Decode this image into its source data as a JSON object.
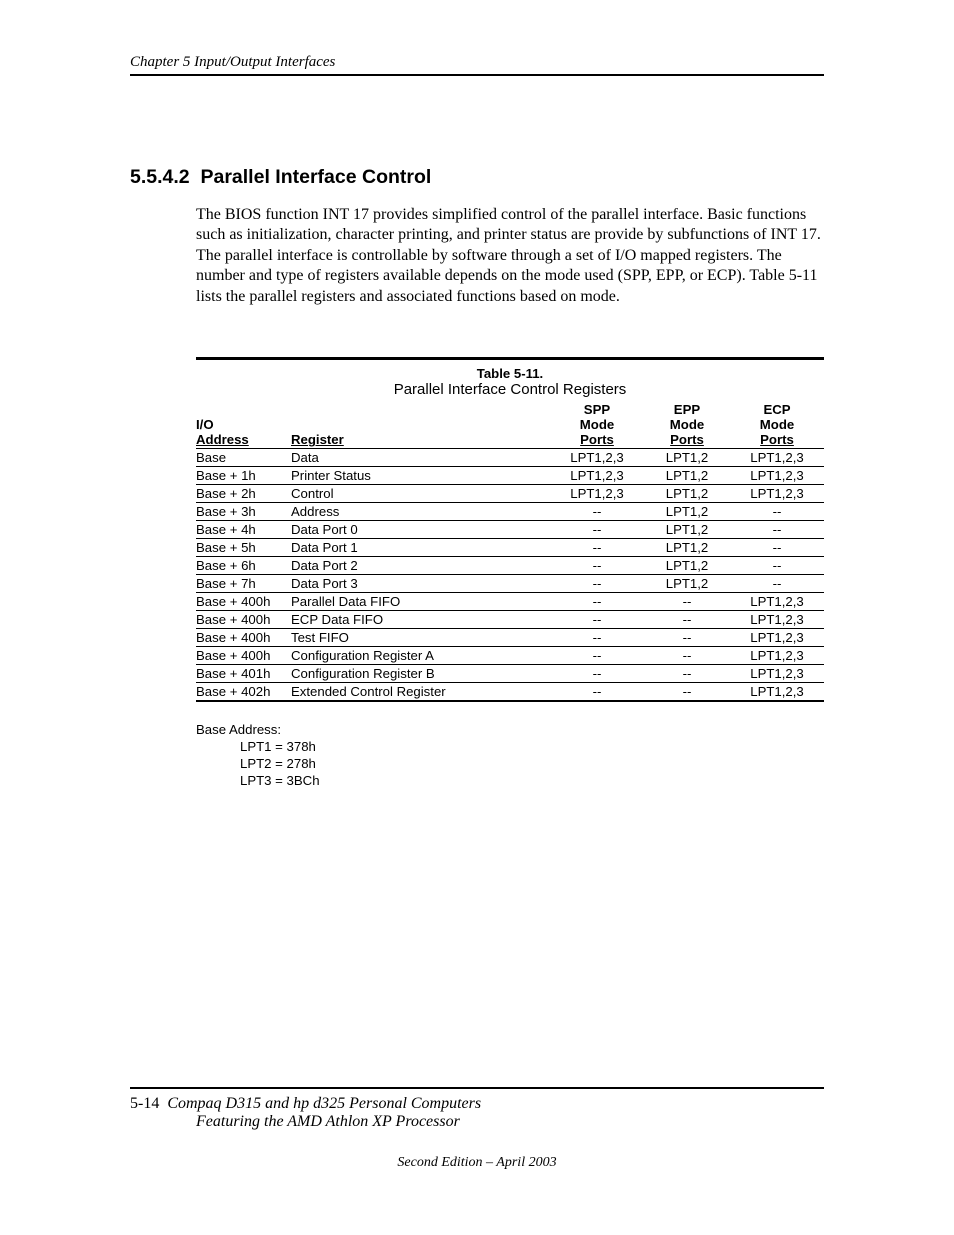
{
  "header": {
    "running": "Chapter 5  Input/Output Interfaces"
  },
  "section": {
    "number": "5.5.4.2",
    "title": "Parallel Interface Control"
  },
  "paragraph": "The BIOS function INT 17 provides simplified control of the parallel interface. Basic functions such as initialization, character printing, and printer status are provide by subfunctions of INT 17. The parallel interface is controllable by software through a set of I/O mapped registers. The number and type of registers available depends on the mode used (SPP, EPP, or ECP). Table 5-11 lists the parallel registers and associated functions based on mode.",
  "table": {
    "number": "Table 5-11.",
    "caption": "Parallel Interface Control Registers",
    "headers": {
      "addr": "I/O Address",
      "reg": "Register",
      "spp": "SPP Mode Ports",
      "epp": "EPP Mode Ports",
      "ecp": "ECP Mode Ports"
    },
    "rows": [
      {
        "addr": "Base",
        "reg": "Data",
        "spp": "LPT1,2,3",
        "epp": "LPT1,2",
        "ecp": "LPT1,2,3"
      },
      {
        "addr": "Base + 1h",
        "reg": "Printer Status",
        "spp": "LPT1,2,3",
        "epp": "LPT1,2",
        "ecp": "LPT1,2,3"
      },
      {
        "addr": "Base + 2h",
        "reg": "Control",
        "spp": "LPT1,2,3",
        "epp": "LPT1,2",
        "ecp": "LPT1,2,3"
      },
      {
        "addr": "Base + 3h",
        "reg": "Address",
        "spp": "--",
        "epp": "LPT1,2",
        "ecp": "--"
      },
      {
        "addr": "Base + 4h",
        "reg": "Data Port 0",
        "spp": "--",
        "epp": "LPT1,2",
        "ecp": "--"
      },
      {
        "addr": "Base + 5h",
        "reg": "Data Port 1",
        "spp": "--",
        "epp": "LPT1,2",
        "ecp": "--"
      },
      {
        "addr": "Base + 6h",
        "reg": "Data Port 2",
        "spp": "--",
        "epp": "LPT1,2",
        "ecp": "--"
      },
      {
        "addr": "Base + 7h",
        "reg": "Data Port 3",
        "spp": "--",
        "epp": "LPT1,2",
        "ecp": "--"
      },
      {
        "addr": "Base + 400h",
        "reg": "Parallel Data FIFO",
        "spp": "--",
        "epp": "--",
        "ecp": "LPT1,2,3"
      },
      {
        "addr": "Base + 400h",
        "reg": "ECP Data FIFO",
        "spp": "--",
        "epp": "--",
        "ecp": "LPT1,2,3"
      },
      {
        "addr": "Base + 400h",
        "reg": "Test FIFO",
        "spp": "--",
        "epp": "--",
        "ecp": "LPT1,2,3"
      },
      {
        "addr": "Base + 400h",
        "reg": "Configuration Register A",
        "spp": "--",
        "epp": "--",
        "ecp": "LPT1,2,3"
      },
      {
        "addr": "Base + 401h",
        "reg": "Configuration Register B",
        "spp": "--",
        "epp": "--",
        "ecp": "LPT1,2,3"
      },
      {
        "addr": "Base + 402h",
        "reg": "Extended Control Register",
        "spp": "--",
        "epp": "--",
        "ecp": "LPT1,2,3"
      }
    ]
  },
  "footnote": {
    "lead": "Base Address:",
    "l1": "LPT1 = 378h",
    "l2": "LPT2 = 278h",
    "l3": "LPT3 = 3BCh"
  },
  "footer": {
    "pagenum": "5-14",
    "title1": "Compaq D315 and hp d325 Personal Computers",
    "title2": "Featuring the AMD Athlon XP Processor",
    "edition": "Second Edition – April 2003"
  }
}
